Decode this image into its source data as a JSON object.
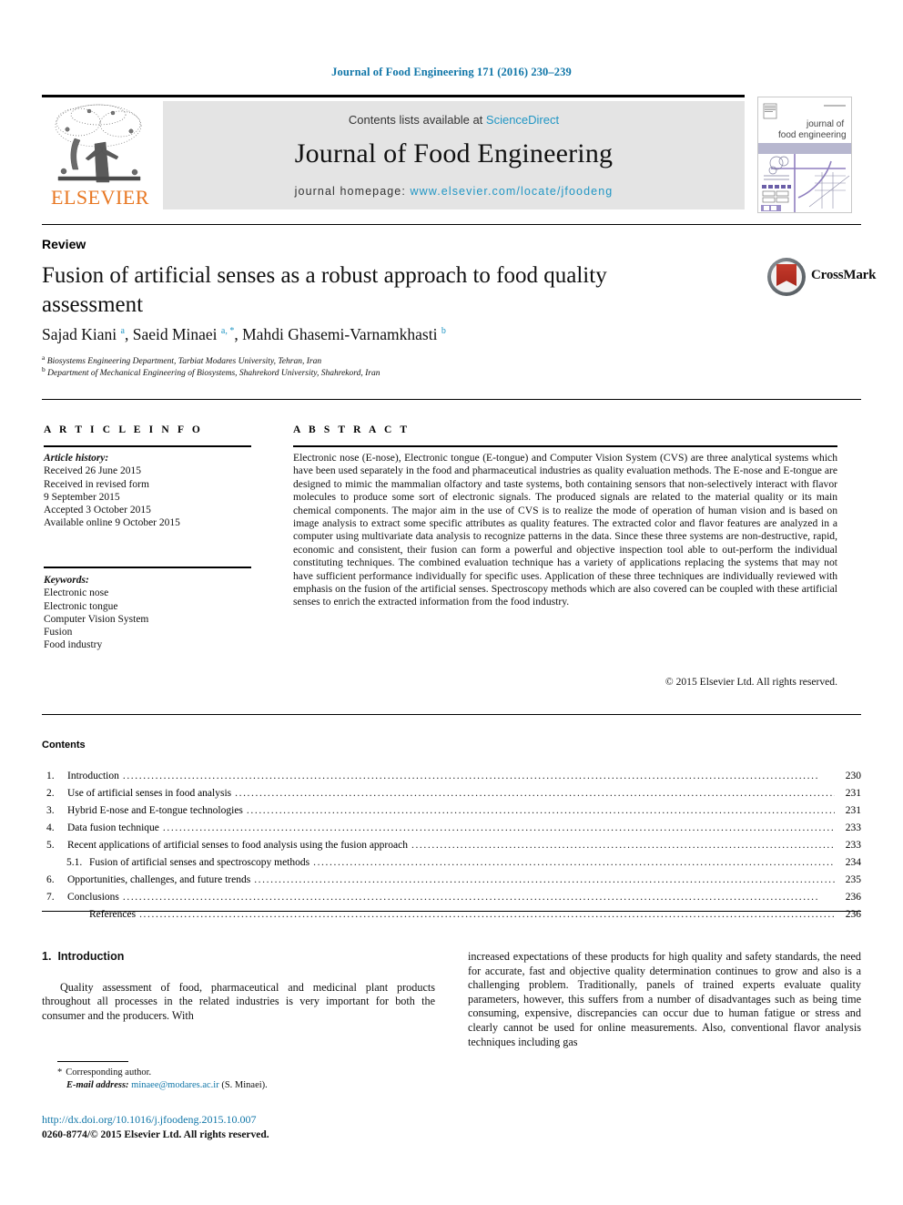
{
  "running_head": "Journal of Food Engineering 171 (2016) 230–239",
  "masthead": {
    "contents_prefix": "Contents lists available at ",
    "sciencedirect": "ScienceDirect",
    "journal_title": "Journal of Food Engineering",
    "homepage_prefix": "journal homepage: ",
    "homepage_url": "www.elsevier.com/locate/jfoodeng",
    "publisher_logo_text": "ELSEVIER",
    "cover_title_line1": "journal of",
    "cover_title_line2": "food engineering",
    "accent_color": "#2196c4",
    "elsevier_orange": "#e87722"
  },
  "article": {
    "doctype": "Review",
    "title": "Fusion of artificial senses as a robust approach to food quality assessment",
    "crossmark_label": "CrossMark",
    "authors": [
      {
        "name": "Sajad Kiani",
        "marks": "a"
      },
      {
        "name": "Saeid Minaei",
        "marks": "a, *"
      },
      {
        "name": "Mahdi Ghasemi-Varnamkhasti",
        "marks": "b"
      }
    ],
    "affiliations": [
      {
        "mark": "a",
        "text": "Biosystems Engineering Department, Tarbiat Modares University, Tehran, Iran"
      },
      {
        "mark": "b",
        "text": "Department of Mechanical Engineering of Biosystems, Shahrekord University, Shahrekord, Iran"
      }
    ]
  },
  "article_info": {
    "heading": "A R T I C L E   I N F O",
    "history_label": "Article history:",
    "history": [
      "Received 26 June 2015",
      "Received in revised form",
      "9 September 2015",
      "Accepted 3 October 2015",
      "Available online 9 October 2015"
    ],
    "keywords_label": "Keywords:",
    "keywords": [
      "Electronic nose",
      "Electronic tongue",
      "Computer Vision System",
      "Fusion",
      "Food industry"
    ]
  },
  "abstract": {
    "heading": "A B S T R A C T",
    "text": "Electronic nose (E-nose), Electronic tongue (E-tongue) and Computer Vision System (CVS) are three analytical systems which have been used separately in the food and pharmaceutical industries as quality evaluation methods. The E-nose and E-tongue are designed to mimic the mammalian olfactory and taste systems, both containing sensors that non-selectively interact with flavor molecules to produce some sort of electronic signals. The produced signals are related to the material quality or its main chemical components. The major aim in the use of CVS is to realize the mode of operation of human vision and is based on image analysis to extract some specific attributes as quality features. The extracted color and flavor features are analyzed in a computer using multivariate data analysis to recognize patterns in the data. Since these three systems are non-destructive, rapid, economic and consistent, their fusion can form a powerful and objective inspection tool able to out-perform the individual constituting techniques. The combined evaluation technique has a variety of applications replacing the systems that may not have sufficient performance individually for specific uses. Application of these three techniques are individually reviewed with emphasis on the fusion of the artificial senses. Spectroscopy methods which are also covered can be coupled with these artificial senses to enrich the extracted information from the food industry.",
    "copyright": "© 2015 Elsevier Ltd. All rights reserved."
  },
  "contents": {
    "heading": "Contents",
    "items": [
      {
        "num": "1.",
        "label": "Introduction",
        "page": "230",
        "sub": false
      },
      {
        "num": "2.",
        "label": "Use of artificial senses in food analysis",
        "page": "231",
        "sub": false
      },
      {
        "num": "3.",
        "label": "Hybrid E-nose and E-tongue technologies",
        "page": "231",
        "sub": false
      },
      {
        "num": "4.",
        "label": "Data fusion technique",
        "page": "233",
        "sub": false
      },
      {
        "num": "5.",
        "label": "Recent applications of artificial senses to food analysis using the fusion approach",
        "page": "233",
        "sub": false
      },
      {
        "num": "5.1.",
        "label": "Fusion of artificial senses and spectroscopy methods",
        "page": "234",
        "sub": true
      },
      {
        "num": "6.",
        "label": "Opportunities, challenges, and future trends",
        "page": "235",
        "sub": false
      },
      {
        "num": "7.",
        "label": "Conclusions",
        "page": "236",
        "sub": false
      },
      {
        "num": "",
        "label": "References",
        "page": "236",
        "sub": true
      }
    ]
  },
  "body": {
    "section_number": "1.",
    "section_title": "Introduction",
    "left_paragraph": "Quality assessment of food, pharmaceutical and medicinal plant products throughout all processes in the related industries is very important for both the consumer and the producers. With",
    "right_paragraph": "increased expectations of these products for high quality and safety standards, the need for accurate, fast and objective quality determination continues to grow and also is a challenging problem. Traditionally, panels of trained experts evaluate quality parameters, however, this suffers from a number of disadvantages such as being time consuming, expensive, discrepancies can occur due to human fatigue or stress and clearly cannot be used for online measurements. Also, conventional flavor analysis techniques including gas"
  },
  "footer": {
    "corresponding_marker": "*",
    "corresponding_label": "Corresponding author.",
    "email_label": "E-mail address:",
    "email": "minaee@modares.ac.ir",
    "email_suffix": "(S. Minaei).",
    "doi": "http://dx.doi.org/10.1016/j.jfoodeng.2015.10.007",
    "issn_line": "0260-8774/© 2015 Elsevier Ltd. All rights reserved."
  }
}
